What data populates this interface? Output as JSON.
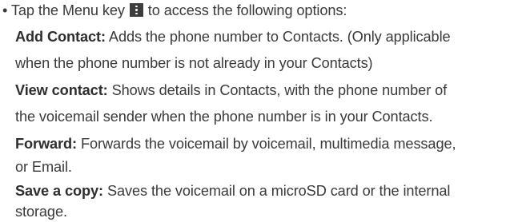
{
  "intro": {
    "bullet": "•",
    "text_before_icon": "Tap the Menu key",
    "icon": "menu-key-icon",
    "text_after_icon": "to access the following options:"
  },
  "options": [
    {
      "title": "Add Contact:",
      "lines": [
        "Adds the phone number to Contacts. (Only applicable",
        "when the phone number is not already in your Contacts)"
      ]
    },
    {
      "title": "View contact:",
      "lines": [
        "Shows details in Contacts, with the phone number of",
        "the voicemail sender when the phone number is in your Contacts."
      ]
    },
    {
      "title": "Forward:",
      "lines": [
        "Forwards the voicemail by voicemail, multimedia message,",
        "or Email."
      ]
    },
    {
      "title": "Save a copy:",
      "lines": [
        "Saves the voicemail on a microSD card or the internal",
        "storage."
      ]
    }
  ]
}
